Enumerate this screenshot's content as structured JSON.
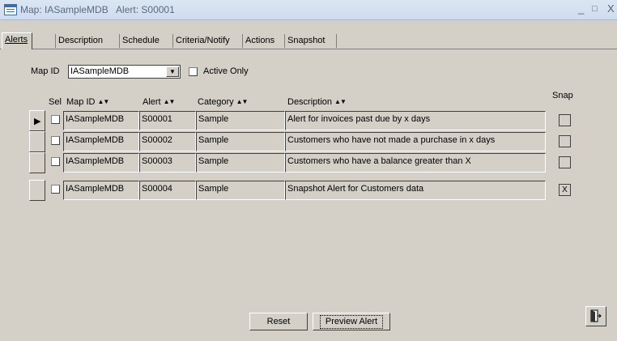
{
  "window": {
    "title": "Map: IASampleMDB   Alert: S00001",
    "minimize": "_",
    "maximize": "□",
    "close": "X"
  },
  "tabs": [
    {
      "label": "Alerts",
      "active": true
    },
    {
      "label": "Description"
    },
    {
      "label": "Schedule"
    },
    {
      "label": "Criteria/Notify"
    },
    {
      "label": "Actions"
    },
    {
      "label": "Snapshot"
    }
  ],
  "filter": {
    "map_id_label": "Map ID",
    "map_id_value": "IASampleMDB",
    "active_only_label": "Active Only",
    "active_only_checked": false
  },
  "columns": {
    "sel": "Sel",
    "map_id": "Map ID",
    "alert": "Alert",
    "category": "Category",
    "description": "Description",
    "snap": "Snap"
  },
  "rows": [
    {
      "map_id": "IASampleMDB",
      "alert": "S00001",
      "category": "Sample",
      "description": "Alert for invoices past due by x days",
      "snap": "",
      "current": true
    },
    {
      "map_id": "IASampleMDB",
      "alert": "S00002",
      "category": "Sample",
      "description": "Customers who have not made a purchase in x days",
      "snap": ""
    },
    {
      "map_id": "IASampleMDB",
      "alert": "S00003",
      "category": "Sample",
      "description": "Customers who have a balance greater than X",
      "snap": ""
    },
    {
      "map_id": "IASampleMDB",
      "alert": "S00004",
      "category": "Sample",
      "description": "Snapshot Alert for Customers data",
      "snap": "X"
    }
  ],
  "buttons": {
    "reset": "Reset",
    "preview": "Preview Alert"
  },
  "icons": {
    "record_selector": "right-triangle",
    "sort": "sort-up-down",
    "exit": "exit-door-icon"
  }
}
